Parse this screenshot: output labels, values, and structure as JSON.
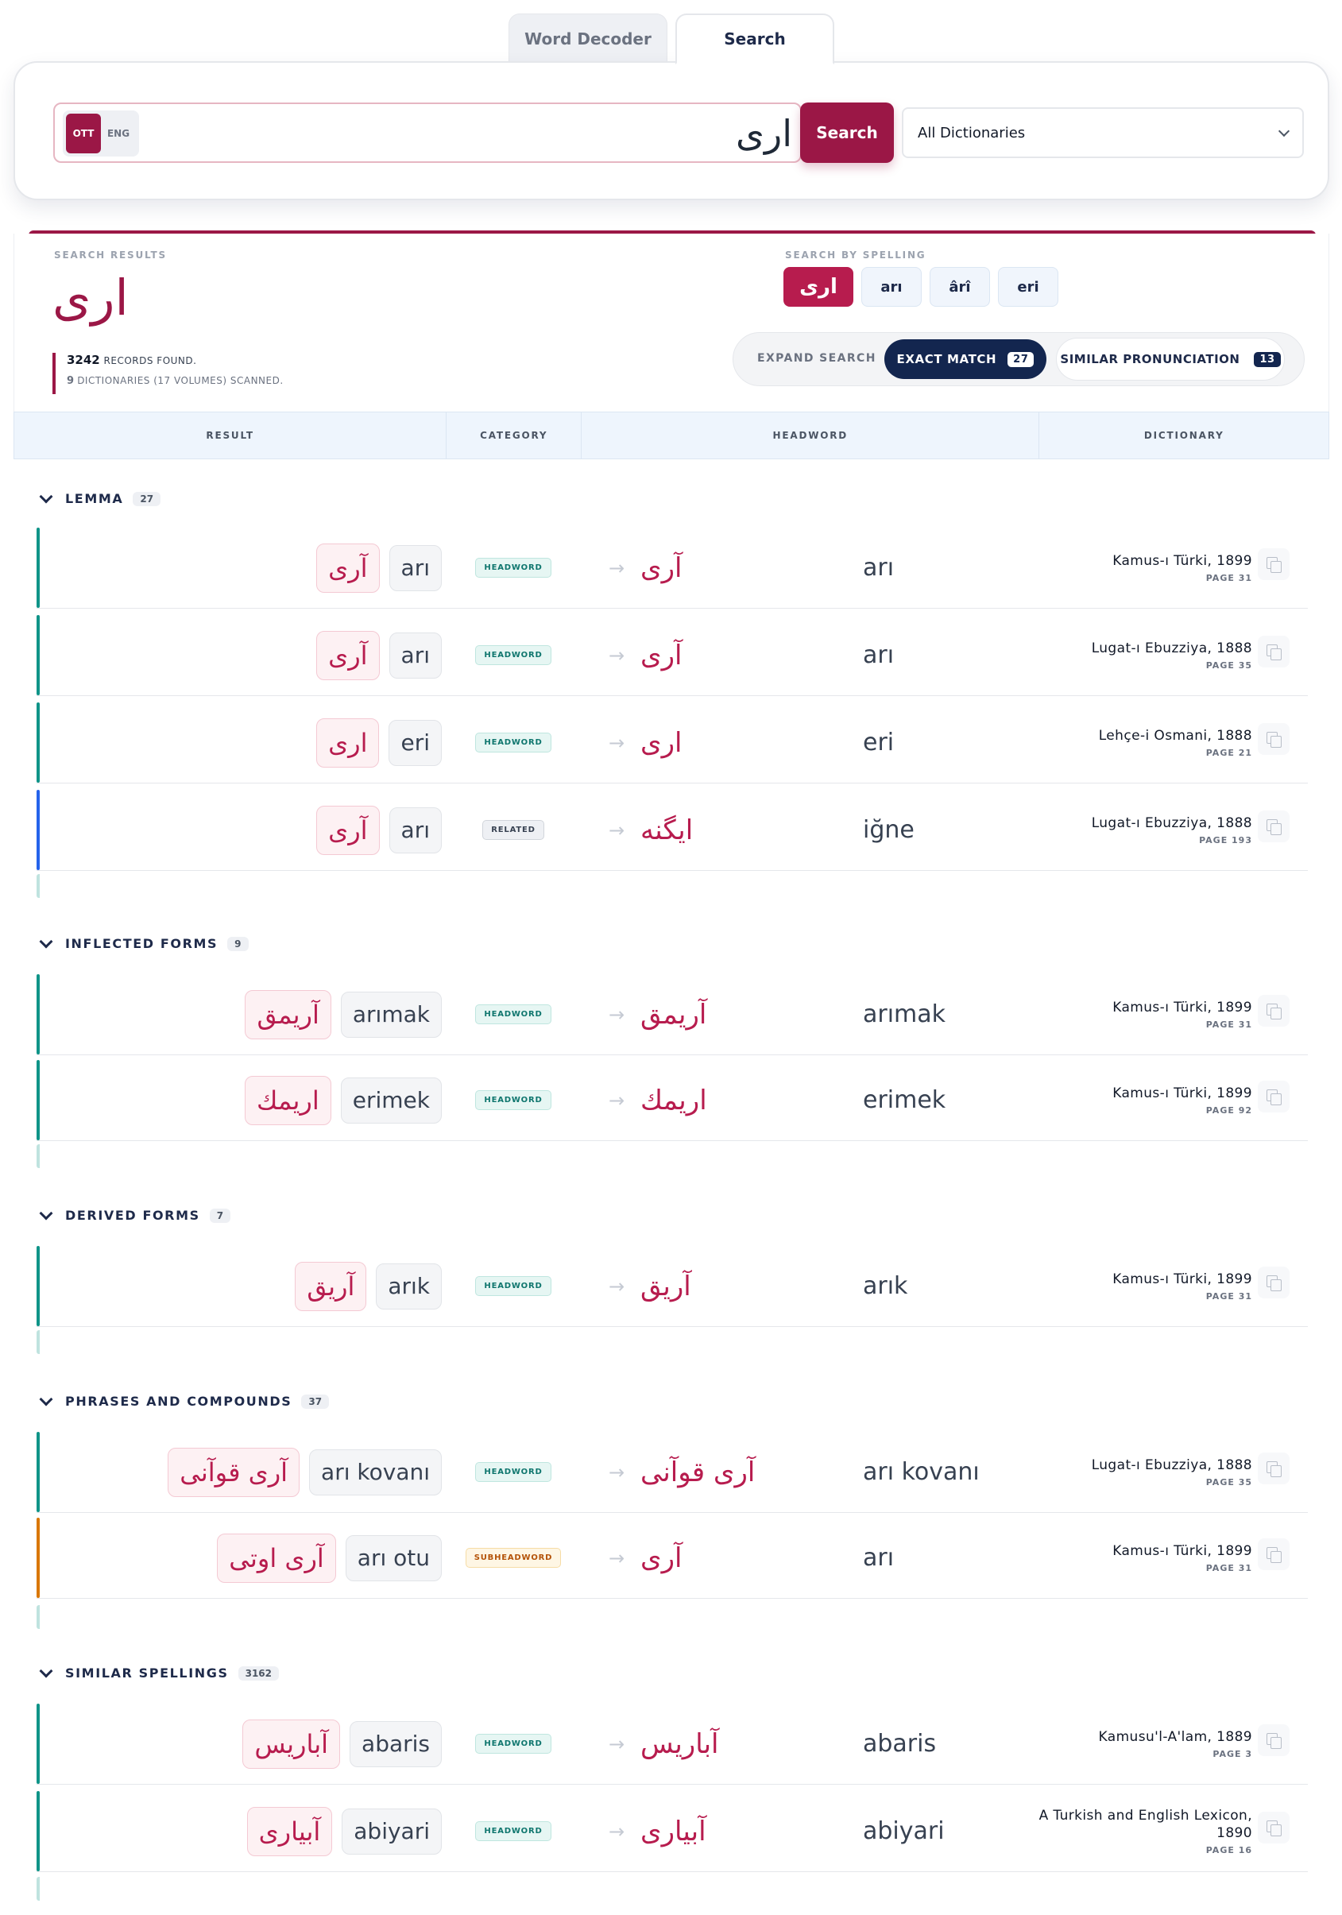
{
  "tabs": [
    {
      "label": "Word Decoder"
    },
    {
      "label": "Search"
    }
  ],
  "search": {
    "lang_ott": "OTT",
    "lang_eng": "ENG",
    "query": "ارى",
    "button": "Search",
    "dictionary_select": "All Dictionaries"
  },
  "results": {
    "label": "SEARCH RESULTS",
    "query": "ارى",
    "records_count": "3242",
    "records_text": "RECORDS FOUND.",
    "dict_count": "9",
    "dict_text": "DICTIONARIES (17 VOLUMES) SCANNED.",
    "spelling_label": "SEARCH BY SPELLING",
    "spellings": [
      "ارى",
      "arı",
      "ârî",
      "eri"
    ],
    "mode_expand": "EXPAND SEARCH",
    "mode_exact": "EXACT MATCH",
    "mode_exact_count": "27",
    "mode_similar": "SIMILAR PRONUNCIATION",
    "mode_similar_count": "13"
  },
  "columns": [
    "RESULT",
    "CATEGORY",
    "HEADWORD",
    "DICTIONARY"
  ],
  "sections": [
    {
      "title": "LEMMA",
      "count": "27",
      "rows": [
        {
          "ott": "آرى",
          "eng": "arı",
          "category": "HEADWORD",
          "hw_ott": "آرى",
          "hw_eng": "arı",
          "dict": "Kamus-ı Türki, 1899",
          "page": "PAGE 31"
        },
        {
          "ott": "آرى",
          "eng": "arı",
          "category": "HEADWORD",
          "hw_ott": "آرى",
          "hw_eng": "arı",
          "dict": "Lugat-ı Ebuzziya, 1888",
          "page": "PAGE 35"
        },
        {
          "ott": "ارى",
          "eng": "eri",
          "category": "HEADWORD",
          "hw_ott": "ارى",
          "hw_eng": "eri",
          "dict": "Lehçe-i Osmani, 1888",
          "page": "PAGE 21"
        },
        {
          "ott": "آرى",
          "eng": "arı",
          "category": "RELATED",
          "hw_ott": "ايگنه",
          "hw_eng": "iğne",
          "dict": "Lugat-ı Ebuzziya, 1888",
          "page": "PAGE 193"
        }
      ]
    },
    {
      "title": "INFLECTED FORMS",
      "count": "9",
      "rows": [
        {
          "ott": "آريمق",
          "eng": "arımak",
          "category": "HEADWORD",
          "hw_ott": "آريمق",
          "hw_eng": "arımak",
          "dict": "Kamus-ı Türki, 1899",
          "page": "PAGE 31"
        },
        {
          "ott": "اريمك",
          "eng": "erimek",
          "category": "HEADWORD",
          "hw_ott": "اريمك",
          "hw_eng": "erimek",
          "dict": "Kamus-ı Türki, 1899",
          "page": "PAGE 92"
        }
      ]
    },
    {
      "title": "DERIVED FORMS",
      "count": "7",
      "rows": [
        {
          "ott": "آريق",
          "eng": "arık",
          "category": "HEADWORD",
          "hw_ott": "آريق",
          "hw_eng": "arık",
          "dict": "Kamus-ı Türki, 1899",
          "page": "PAGE 31"
        }
      ]
    },
    {
      "title": "PHRASES AND COMPOUNDS",
      "count": "37",
      "rows": [
        {
          "ott": "آرى قوآنى",
          "eng": "arı kovanı",
          "category": "HEADWORD",
          "hw_ott": "آرى قوآنى",
          "hw_eng": "arı kovanı",
          "dict": "Lugat-ı Ebuzziya, 1888",
          "page": "PAGE 35"
        },
        {
          "ott": "آرى اوتى",
          "eng": "arı otu",
          "category": "SUBHEADWORD",
          "hw_ott": "آرى",
          "hw_eng": "arı",
          "dict": "Kamus-ı Türki, 1899",
          "page": "PAGE 31"
        }
      ]
    },
    {
      "title": "SIMILAR SPELLINGS",
      "count": "3162",
      "rows": [
        {
          "ott": "آباريس",
          "eng": "abaris",
          "category": "HEADWORD",
          "hw_ott": "آباريس",
          "hw_eng": "abaris",
          "dict": "Kamusu'l-A'lam, 1889",
          "page": "PAGE 3"
        },
        {
          "ott": "آبيارى",
          "eng": "abiyari",
          "category": "HEADWORD",
          "hw_ott": "آبيارى",
          "hw_eng": "abiyari",
          "dict": "A Turkish and English Lexicon, 1890",
          "page": "PAGE 16"
        }
      ]
    }
  ],
  "colors": {
    "brand": "#9b1746",
    "navy": "#13264f",
    "teal_accent": "#0f9488",
    "blue_accent": "#2563eb",
    "orange_accent": "#d97706"
  }
}
